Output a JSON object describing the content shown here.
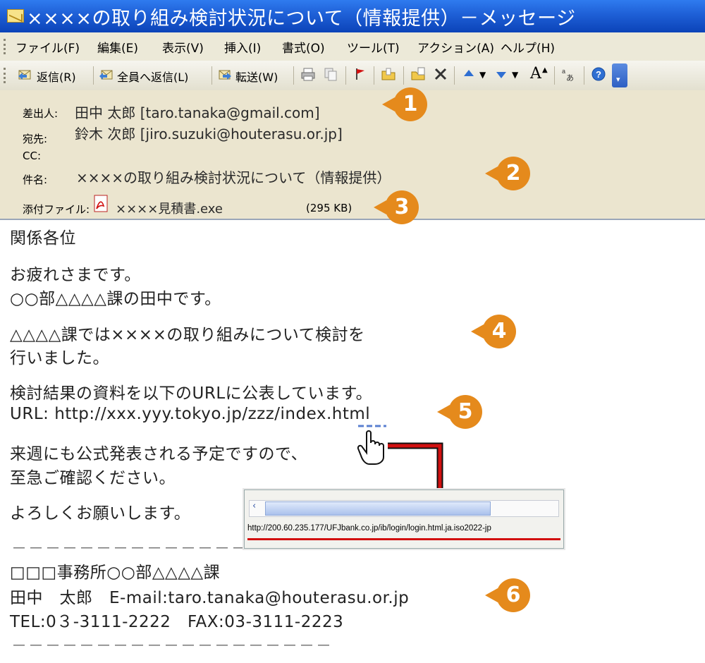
{
  "window": {
    "title": "××××の取り組み検討状況について（情報提供）－メッセージ"
  },
  "menu": [
    "ファイル(F)",
    "編集(E)",
    "表示(V)",
    "挿入(I)",
    "書式(O)",
    "ツール(T)",
    "アクション(A)",
    "ヘルプ(H)"
  ],
  "toolbar": {
    "reply": "返信(R)",
    "reply_all": "全員へ返信(L)",
    "forward": "転送(W)",
    "font_size_glyph": "A"
  },
  "header": {
    "from_label": "差出人:",
    "from_value": "田中 太郎 [taro.tanaka@gmail.com]",
    "to_label": "宛先:",
    "to_value": "鈴木 次郎 [jiro.suzuki@houterasu.or.jp]",
    "cc_label": "CC:",
    "subject_label": "件名:",
    "subject_value": "××××の取り組み検討状況について（情報提供）",
    "attach_label": "添付ファイル:",
    "attach_name": "××××見積書.exe",
    "attach_size": "(295 KB)"
  },
  "body": {
    "greeting": "関係各位",
    "line1": "お疲れさまです。",
    "line2": "○○部△△△△課の田中です。",
    "line3": "△△△△課では××××の取り組みについて検討を",
    "line4": "行いました。",
    "line5": "検討結果の資料を以下のURLに公表しています。",
    "line6": "URL: http://xxx.yyy.tokyo.jp/zzz/index.html",
    "line7": "来週にも公式発表される予定ですので、",
    "line8": "至急ご確認ください。",
    "line9": "よろしくお願いします。",
    "dashes": "－－－－－－－－－－－－－－－－－－－",
    "sig1": "□□□事務所○○部△△△△課",
    "sig2": "田中　太郎　E-mail:taro.tanaka@houterasu.or.jp",
    "sig3": "TEL:0３-3111-2222　FAX:03-3111-2223"
  },
  "statusbar": {
    "url": "http://200.60.235.177/UFJbank.co.jp/ib/login/login.html.ja.iso2022-jp"
  },
  "callouts": [
    "1",
    "2",
    "3",
    "4",
    "5",
    "6"
  ],
  "colors": {
    "callout": "#e58a1c",
    "titlebar": "#1e5fd6",
    "header_bg": "#ebe5cf",
    "warning_red": "#d21010"
  }
}
